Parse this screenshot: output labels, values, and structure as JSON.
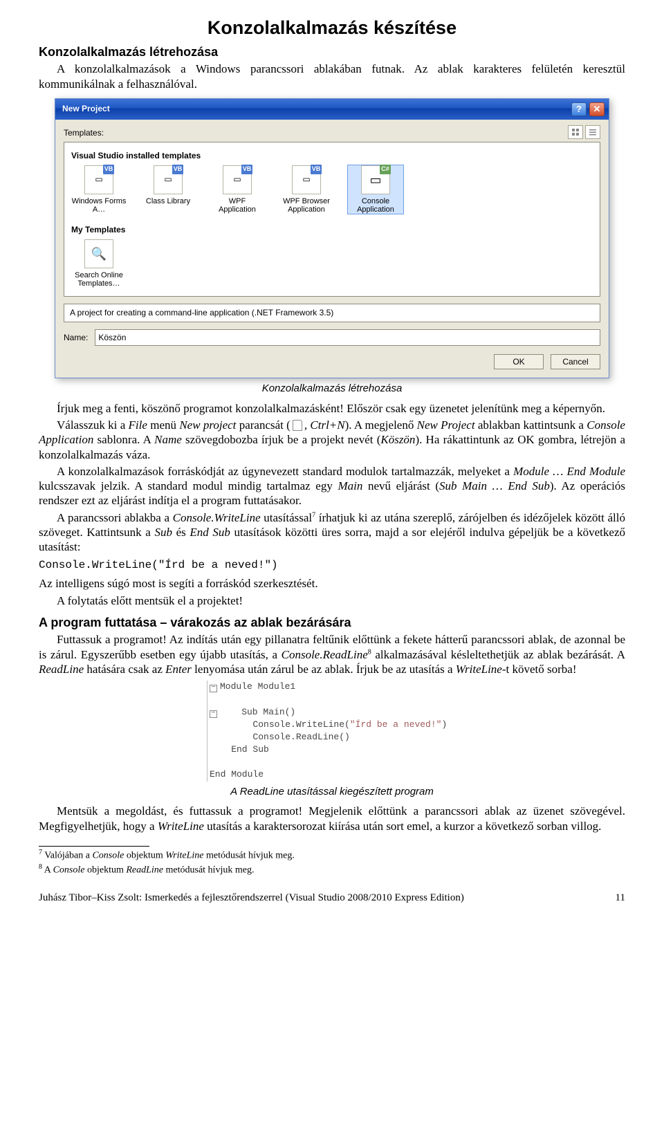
{
  "title": "Konzolalkalmazás készítése",
  "section1_heading": "Konzolalkalmazás létrehozása",
  "para1": "A konzolalkalmazások a Windows parancssori ablakában futnak. Az ablak karakteres felületén keresztül kommunikálnak a felhasználóval.",
  "dialog": {
    "title": "New Project",
    "templates_label": "Templates:",
    "group1": "Visual Studio installed templates",
    "items": [
      {
        "label": "Windows Forms A…",
        "badge": "VB"
      },
      {
        "label": "Class Library",
        "badge": "VB"
      },
      {
        "label": "WPF Application",
        "badge": "VB"
      },
      {
        "label": "WPF Browser Application",
        "badge": "VB"
      },
      {
        "label": "Console Application",
        "badge": "C#"
      }
    ],
    "group2": "My Templates",
    "search_label": "Search Online Templates…",
    "description": "A project for creating a command-line application (.NET Framework 3.5)",
    "name_label": "Name:",
    "name_value": "Köszön",
    "ok": "OK",
    "cancel": "Cancel"
  },
  "caption1": "Konzolalkalmazás létrehozása",
  "para2a": "Írjuk meg a fenti, köszönő programot konzolalkalmazásként! Először csak egy üzenetet jelenítünk meg a képernyőn.",
  "para2b_pre": "Válasszuk ki a ",
  "para2b_em1": "File",
  "para2b_mid1": " menü ",
  "para2b_em2": "New project",
  "para2b_mid2": " parancsát (",
  "para2b_em3": ", Ctrl+N",
  "para2b_mid3": "). A megjelenő ",
  "para2b_em4": "New Project",
  "para2b_mid4": " ablakban kattintsunk a ",
  "para2b_em5": "Console Application",
  "para2b_mid5": " sablonra. A ",
  "para2b_em6": "Name",
  "para2b_mid6": " szövegdobozba írjuk be a projekt nevét (",
  "para2b_em7": "Köszön",
  "para2b_mid7": "). Ha rákattintunk az OK gombra, létrejön a konzolalkalmazás váza.",
  "para3_pre": "A konzolalkalmazások forráskódját az úgynevezett standard modulok tartalmazzák, melyeket a ",
  "para3_em1": "Module … End Module",
  "para3_mid1": " kulcsszavak jelzik. A standard modul mindig tartalmaz egy ",
  "para3_em2": "Main",
  "para3_mid2": " nevű eljárást (",
  "para3_em3": "Sub Main … End Sub",
  "para3_mid3": "). Az operációs rendszer ezt az eljárást indítja el a program futtatásakor.",
  "para4_pre": "A parancssori ablakba a ",
  "para4_em1": "Console.WriteLine",
  "para4_mid1": " utasítással",
  "para4_sup": "7",
  "para4_mid2": " írhatjuk ki az utána szereplő, zárójelben és idézőjelek között álló szöveget. Kattintsunk a ",
  "para4_em2": "Sub",
  "para4_mid3": " és ",
  "para4_em3": "End Sub",
  "para4_mid4": " utasítások közötti üres sorra, majd a sor elejéről indulva gépeljük be a következő utasítást:",
  "codeline": "Console.WriteLine(\"Írd be a neved!\")",
  "para5": "Az intelligens súgó most is segíti a forráskód szerkesztését.",
  "para6": "A folytatás előtt mentsük el a projektet!",
  "section2_heading": "A program futtatása – várakozás az ablak bezárására",
  "para7_pre": "Futtassuk a programot! Az indítás után egy pillanatra feltűnik előttünk a fekete hátterű parancssori ablak, de azonnal be is zárul. Egyszerűbb esetben egy újabb utasítás, a ",
  "para7_em1": "Console.ReadLine",
  "para7_sup": "8",
  "para7_mid1": " alkalmazásával késleltethetjük az ablak bezárását. A ",
  "para7_em2": "ReadLine",
  "para7_mid2": " hatására csak az ",
  "para7_em3": "Enter",
  "para7_mid3": " lenyomása után zárul be az ablak. Írjuk be az utasítás a ",
  "para7_em4": "WriteLine",
  "para7_mid4": "-t követő sorba!",
  "codefig": {
    "l1": "Module Module1",
    "l2": "    Sub Main()",
    "l3_a": "        Console.WriteLine(",
    "l3_s": "\"Írd be a neved!\"",
    "l3_b": ")",
    "l4": "        Console.ReadLine()",
    "l5": "    End Sub",
    "l6": "End Module"
  },
  "caption2": "A ReadLine utasítással kiegészített program",
  "para8_pre": "Mentsük a megoldást, és futtassuk a programot! Megjelenik előttünk a parancssori ablak az üzenet szövegével. Megfigyelhetjük, hogy a ",
  "para8_em1": "WriteLine",
  "para8_mid": " utasítás a karaktersorozat kiírása után sort emel, a kurzor a következő sorban villog.",
  "fn7_pre": " Valójában a ",
  "fn7_em1": "Console",
  "fn7_mid1": " objektum ",
  "fn7_em2": "WriteLine",
  "fn7_mid2": " metódusát hívjuk meg.",
  "fn8_pre": " A ",
  "fn8_em1": "Console",
  "fn8_mid1": " objektum ",
  "fn8_em2": "ReadLine",
  "fn8_mid2": " metódusát hívjuk meg.",
  "footer_left": "Juhász Tibor–Kiss Zsolt: Ismerkedés a fejlesztőrendszerrel (Visual Studio 2008/2010 Express Edition)",
  "footer_right": "11"
}
